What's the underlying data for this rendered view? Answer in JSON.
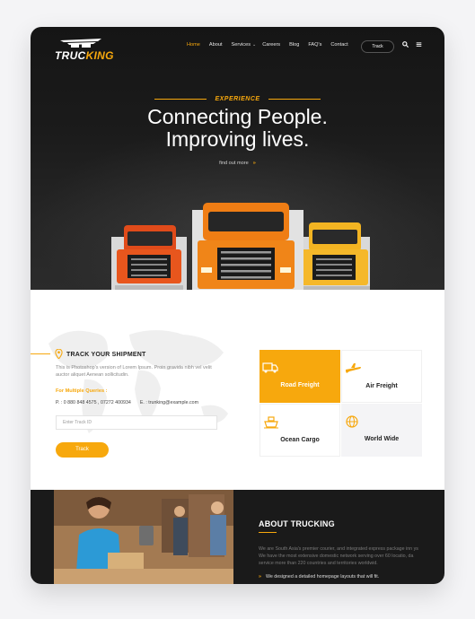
{
  "brand": {
    "logo_text_a": "TRUC",
    "logo_text_b": "KING",
    "accent": "#f7a80d"
  },
  "nav": {
    "items": [
      {
        "label": "Home",
        "active": true
      },
      {
        "label": "About",
        "active": false
      },
      {
        "label": "Services",
        "active": false
      },
      {
        "label": "Careers",
        "active": false
      },
      {
        "label": "Blog",
        "active": false
      },
      {
        "label": "FAQ's",
        "active": false
      },
      {
        "label": "Contact",
        "active": false
      }
    ],
    "track_button": "Track",
    "icons": [
      "search-icon",
      "menu-icon"
    ]
  },
  "hero": {
    "eyebrow": "EXPERIENCE",
    "headline_line1": "Connecting People.",
    "headline_line2": "Improving lives.",
    "link": "find out more"
  },
  "track": {
    "title": "TRACK YOUR SHIPMENT",
    "description": "This is Photoshop's version of Lorem Ipsum. Proin gravida nibh vel velit auctor aliquet Aenean sollicitudin.",
    "multiple_queries": "For Multiple Queries :",
    "phone": "P. : 0 880 848 4575 , 07272 400934",
    "email": "E. : trunking@example.com",
    "input_placeholder": "Enter Track ID",
    "button": "Track"
  },
  "services": [
    {
      "label": "Road Freight",
      "icon": "truck-icon",
      "highlighted": true
    },
    {
      "label": "Air Freight",
      "icon": "airplane-icon",
      "highlighted": false
    },
    {
      "label": "Ocean Cargo",
      "icon": "ship-icon",
      "highlighted": false
    },
    {
      "label": "World Wide",
      "icon": "globe-icon",
      "highlighted": false
    }
  ],
  "about": {
    "title": "ABOUT TRUCKING",
    "text": "We are South Asia's premier courier, and integrated express package inn ys We have the most extensive domestic network serving over 60 locatio, da service more than 220 countries and territories worldwid.",
    "bullet": "We designed a detailed homepage layouts that will fit."
  }
}
